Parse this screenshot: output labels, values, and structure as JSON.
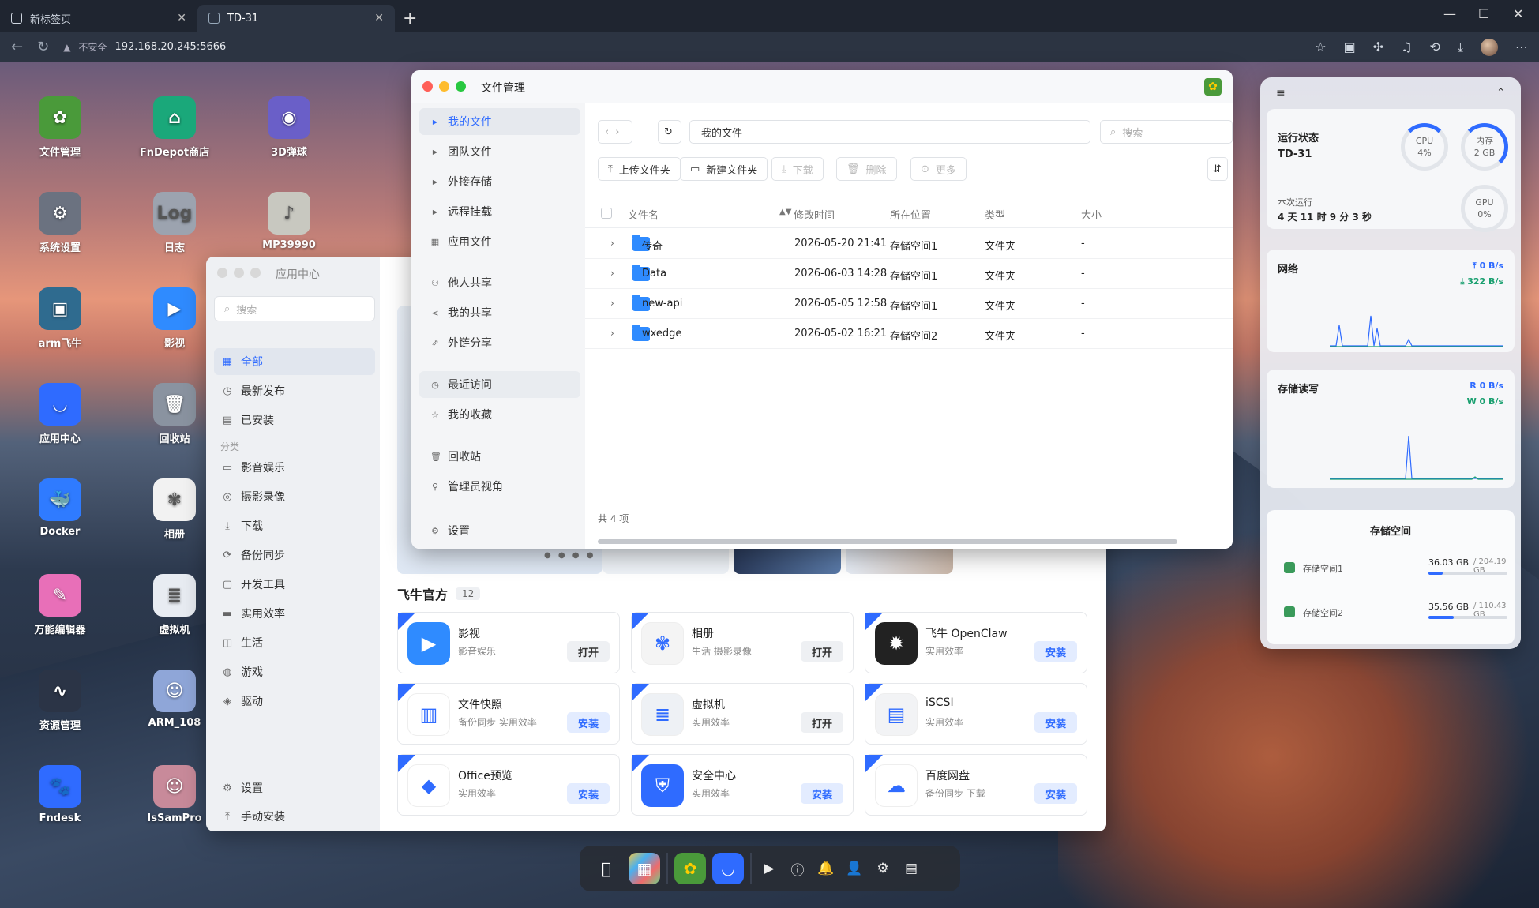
{
  "browser": {
    "tabs": [
      {
        "label": "新标签页"
      },
      {
        "label": "TD-31"
      }
    ],
    "warning": "不安全",
    "url": "192.168.20.245:5666"
  },
  "desktop_icons": [
    {
      "label": "文件管理",
      "icon": "sunflower-icon",
      "color": "#4a9a3a"
    },
    {
      "label": "FnDepot商店",
      "icon": "store-icon",
      "color": "#1aa87a"
    },
    {
      "label": "3D弹球",
      "icon": "pinball-icon",
      "color": "#6a5fc8"
    },
    {
      "label": "系统设置",
      "icon": "gear-icon",
      "color": "#6b7280"
    },
    {
      "label": "日志",
      "icon": "log-icon",
      "color": "#9ca3af"
    },
    {
      "label": "MP39990",
      "icon": "mp3-icon",
      "color": "#c8c8c0"
    },
    {
      "label": "arm飞牛",
      "icon": "monitor-icon",
      "color": "#2f6b8f"
    },
    {
      "label": "影视",
      "icon": "video-icon",
      "color": "#2f8bff"
    },
    {
      "label": "应用中心",
      "icon": "store-bag-icon",
      "color": "#2f6bff"
    },
    {
      "label": "回收站",
      "icon": "trash-icon",
      "color": "#8a93a0"
    },
    {
      "label": "Docker",
      "icon": "docker-icon",
      "color": "#2f7bff"
    },
    {
      "label": "相册",
      "icon": "photos-icon",
      "color": "#f2f2f2"
    },
    {
      "label": "万能编辑器",
      "icon": "editor-icon",
      "color": "#e86fb8"
    },
    {
      "label": "虚拟机",
      "icon": "vm-icon",
      "color": "#e8ecf2"
    },
    {
      "label": "资源管理",
      "icon": "activity-icon",
      "color": "#2b3446"
    },
    {
      "label": "ARM_108",
      "icon": "anime-icon",
      "color": "#8fa6d8"
    },
    {
      "label": "Fndesk",
      "icon": "paw-icon",
      "color": "#2f6bff"
    },
    {
      "label": "IsSamPro",
      "icon": "anime2-icon",
      "color": "#c88a9a"
    }
  ],
  "appcenter": {
    "title": "应用中心",
    "search_placeholder": "搜索",
    "nav": [
      {
        "label": "全部",
        "icon": "grid-icon"
      },
      {
        "label": "最新发布",
        "icon": "clock-icon"
      },
      {
        "label": "已安装",
        "icon": "installed-icon"
      }
    ],
    "category_label": "分类",
    "categories": [
      {
        "label": "影音娱乐",
        "icon": "media-icon"
      },
      {
        "label": "摄影录像",
        "icon": "camera-icon"
      },
      {
        "label": "下载",
        "icon": "download-icon"
      },
      {
        "label": "备份同步",
        "icon": "sync-icon"
      },
      {
        "label": "开发工具",
        "icon": "dev-icon"
      },
      {
        "label": "实用效率",
        "icon": "briefcase-icon"
      },
      {
        "label": "生活",
        "icon": "life-icon"
      },
      {
        "label": "游戏",
        "icon": "game-icon"
      },
      {
        "label": "驱动",
        "icon": "driver-icon"
      }
    ],
    "bottom": [
      {
        "label": "设置",
        "icon": "gear-icon"
      },
      {
        "label": "手动安装",
        "icon": "upload-icon"
      }
    ],
    "section_title": "飞牛官方",
    "section_count": "12",
    "apps": [
      {
        "name": "影视",
        "sub": "影音娱乐",
        "action": "打开",
        "kind": "open",
        "color": "#2f8bff",
        "icon": "video-icon"
      },
      {
        "name": "相册",
        "sub": "生活 摄影录像",
        "action": "打开",
        "kind": "open",
        "color": "#f4f4f4",
        "icon": "photos-icon"
      },
      {
        "name": "飞牛 OpenClaw",
        "sub": "实用效率",
        "action": "安装",
        "kind": "install",
        "color": "#222222",
        "icon": "claw-icon"
      },
      {
        "name": "文件快照",
        "sub": "备份同步 实用效率",
        "action": "安装",
        "kind": "install",
        "color": "#ffffff",
        "icon": "snapshot-icon"
      },
      {
        "name": "虚拟机",
        "sub": "实用效率",
        "action": "打开",
        "kind": "open",
        "color": "#eef1f5",
        "icon": "vm-icon"
      },
      {
        "name": "iSCSI",
        "sub": "实用效率",
        "action": "安装",
        "kind": "install",
        "color": "#f2f3f5",
        "icon": "iscsi-icon"
      },
      {
        "name": "Office预览",
        "sub": "实用效率",
        "action": "安装",
        "kind": "install",
        "color": "#ffffff",
        "icon": "layers-icon"
      },
      {
        "name": "安全中心",
        "sub": "实用效率",
        "action": "安装",
        "kind": "install",
        "color": "#2f6bff",
        "icon": "shield-icon"
      },
      {
        "name": "百度网盘",
        "sub": "备份同步 下载",
        "action": "安装",
        "kind": "install",
        "color": "#ffffff",
        "icon": "cloud-icon"
      }
    ]
  },
  "filemanager": {
    "title": "文件管理",
    "nav": [
      {
        "label": "我的文件",
        "icon": "caret-right-icon"
      },
      {
        "label": "团队文件",
        "icon": "caret-right-icon"
      },
      {
        "label": "外接存储",
        "icon": "caret-right-icon"
      },
      {
        "label": "远程挂载",
        "icon": "caret-right-icon"
      },
      {
        "label": "应用文件",
        "icon": "grid-icon"
      },
      {
        "label": "他人共享",
        "icon": "users-icon"
      },
      {
        "label": "我的共享",
        "icon": "share-icon"
      },
      {
        "label": "外链分享",
        "icon": "link-icon"
      },
      {
        "label": "最近访问",
        "icon": "clock-icon"
      },
      {
        "label": "我的收藏",
        "icon": "star-icon"
      },
      {
        "label": "回收站",
        "icon": "trash-icon"
      },
      {
        "label": "管理员视角",
        "icon": "admin-icon"
      },
      {
        "label": "设置",
        "icon": "gear-icon"
      }
    ],
    "path": "我的文件",
    "search_placeholder": "搜索",
    "toolbar": {
      "upload": "上传文件夹",
      "newfolder": "新建文件夹",
      "download": "下载",
      "delete": "删除",
      "more": "更多"
    },
    "columns": {
      "name": "文件名",
      "mtime": "修改时间",
      "location": "所在位置",
      "type": "类型",
      "size": "大小"
    },
    "rows": [
      {
        "name": "传奇",
        "mtime": "2026-05-20 21:41",
        "location": "存储空间1",
        "type": "文件夹",
        "size": "-"
      },
      {
        "name": "Data",
        "mtime": "2026-06-03 14:28",
        "location": "存储空间1",
        "type": "文件夹",
        "size": "-"
      },
      {
        "name": "new-api",
        "mtime": "2026-05-05 12:58",
        "location": "存储空间1",
        "type": "文件夹",
        "size": "-"
      },
      {
        "name": "wxedge",
        "mtime": "2026-05-02 16:21",
        "location": "存储空间2",
        "type": "文件夹",
        "size": "-"
      }
    ],
    "footer": "共 4 项"
  },
  "monitor": {
    "status_title": "运行状态",
    "host": "TD-31",
    "cpu_label": "CPU",
    "cpu_value": "4%",
    "mem_label": "内存",
    "mem_value": "2 GB",
    "gpu_label": "GPU",
    "gpu_value": "0%",
    "uptime_label": "本次运行",
    "uptime": "4 天 11 时 9 分 3 秒",
    "network_title": "网络",
    "net_up": "0 B/s",
    "net_down": "322 B/s",
    "disk_title": "存储读写",
    "disk_read": "R 0 B/s",
    "disk_write": "W 0 B/s",
    "storage_title": "存储空间",
    "volumes": [
      {
        "name": "存储空间1",
        "used": "36.03 GB",
        "total": "/ 204.19 GB",
        "fraction": 0.18
      },
      {
        "name": "存储空间2",
        "used": "35.56 GB",
        "total": "/ 110.43 GB",
        "fraction": 0.32
      }
    ]
  },
  "colors": {
    "accent": "#2f6bff",
    "folder": "#2f8bff"
  }
}
